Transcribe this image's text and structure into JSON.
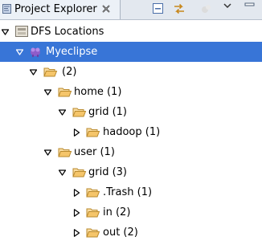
{
  "view": {
    "tab_title": "Project Explorer",
    "close_icon": "close-x-icon",
    "toolbar": [
      {
        "name": "collapse-all-icon"
      },
      {
        "name": "link-with-editor-icon"
      },
      {
        "name": "view-menu-icon"
      },
      {
        "name": "view-menu-chevron-icon"
      }
    ]
  },
  "tree": {
    "rows": [
      {
        "label": "DFS Locations",
        "icon": "dfs-locations-icon",
        "expanded": true,
        "selected": false
      },
      {
        "label": "Myeclipse",
        "icon": "hadoop-location-icon",
        "expanded": true,
        "selected": true
      },
      {
        "label": "(2)",
        "icon": "folder-icon",
        "expanded": true,
        "selected": false
      },
      {
        "label": "home (1)",
        "icon": "folder-icon",
        "expanded": true,
        "selected": false
      },
      {
        "label": "grid (1)",
        "icon": "folder-icon",
        "expanded": true,
        "selected": false
      },
      {
        "label": "hadoop (1)",
        "icon": "folder-icon",
        "expanded": false,
        "selected": false
      },
      {
        "label": "user (1)",
        "icon": "folder-icon",
        "expanded": true,
        "selected": false
      },
      {
        "label": "grid (3)",
        "icon": "folder-icon",
        "expanded": true,
        "selected": false
      },
      {
        "label": ".Trash (1)",
        "icon": "folder-icon",
        "expanded": false,
        "selected": false
      },
      {
        "label": "in (2)",
        "icon": "folder-icon",
        "expanded": false,
        "selected": false
      },
      {
        "label": "out (2)",
        "icon": "folder-icon",
        "expanded": false,
        "selected": false
      }
    ]
  },
  "colors": {
    "selection": "#3875d7",
    "folder": "#f5c56a",
    "tab_background": "#ecf1f7"
  }
}
